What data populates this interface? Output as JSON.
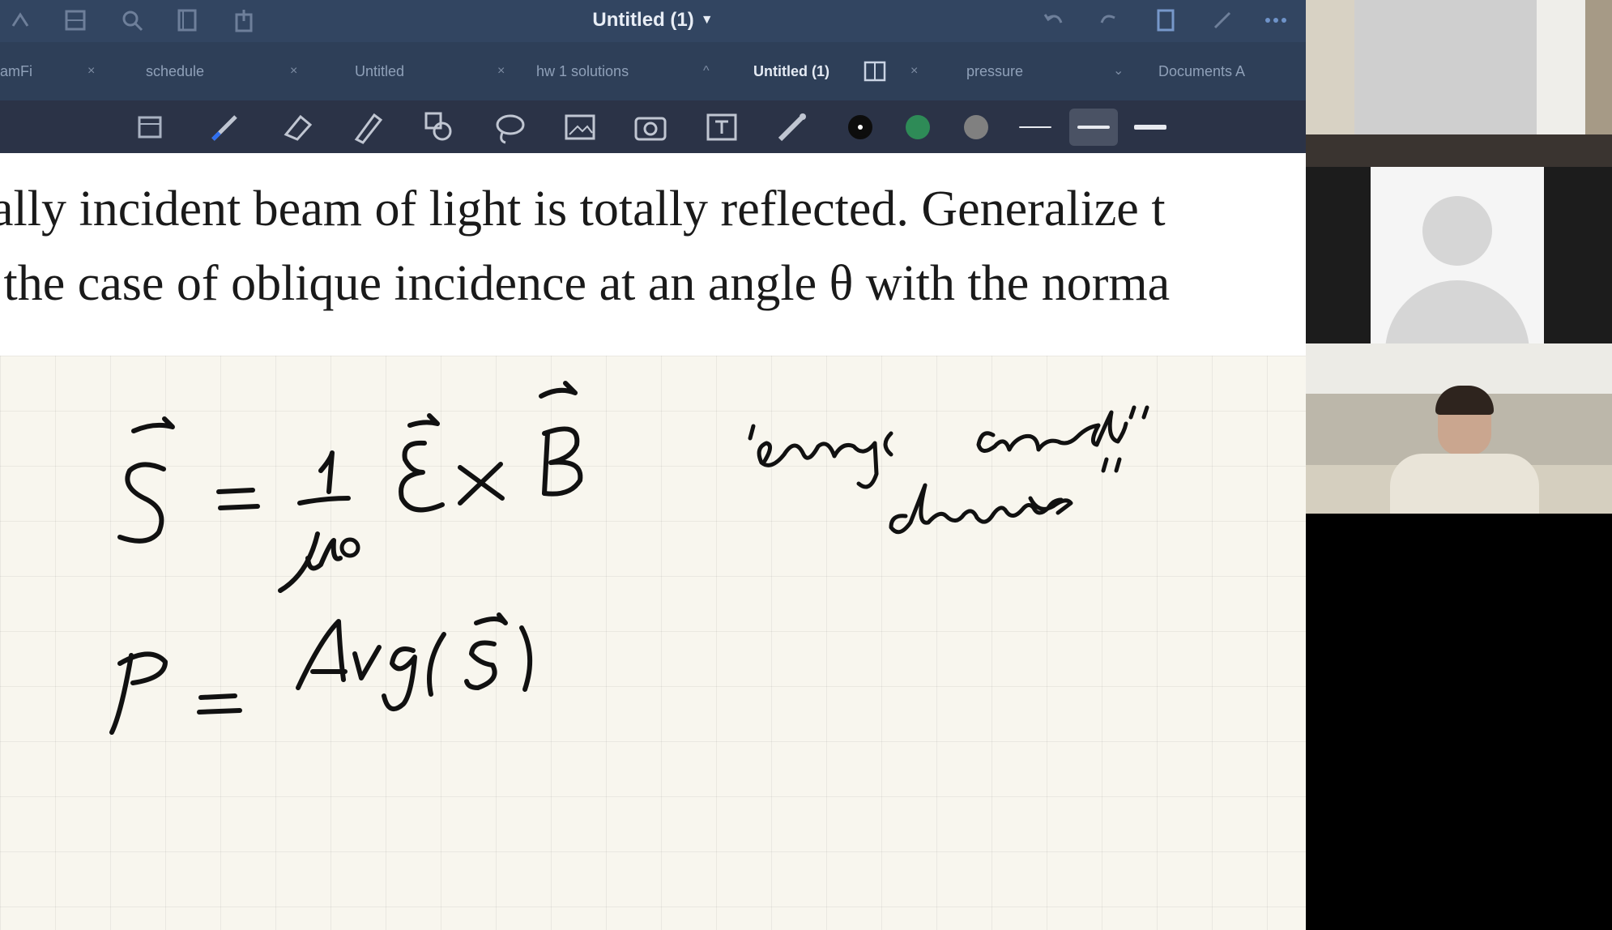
{
  "app": {
    "title": "Untitled (1)",
    "tabs": [
      {
        "label": "amFi"
      },
      {
        "label": "schedule"
      },
      {
        "label": "Untitled"
      },
      {
        "label": "hw 1 solutions"
      },
      {
        "label": "Untitled (1)",
        "active": true
      },
      {
        "label": "pressure"
      },
      {
        "label": "Documents A"
      }
    ],
    "toolbar": {
      "tools": [
        "page-layout-icon",
        "pen-icon",
        "eraser-icon",
        "highlighter-icon",
        "shapes-icon",
        "lasso-icon",
        "image-icon",
        "camera-icon",
        "text-box-icon",
        "laser-pointer-icon"
      ],
      "colors": [
        "#111111",
        "#2e8b57",
        "#8a8a8a"
      ],
      "stroke_widths": [
        "thin",
        "medium",
        "thick"
      ]
    }
  },
  "document": {
    "text_lines": [
      "nally incident beam of light is totally reflected. Generalize t",
      "o the case of oblique incidence at an angle θ with the norma"
    ],
    "handwriting": {
      "eq1": "S⃗ = 1/μ₀ E⃗ × B⃗",
      "note": "“energy current density”",
      "eq2": "P = Avg(S⃗)"
    }
  },
  "participants": [
    {
      "video": "room-camera"
    },
    {
      "video": "avatar-placeholder"
    },
    {
      "video": "person-camera"
    },
    {
      "video": "empty"
    }
  ]
}
